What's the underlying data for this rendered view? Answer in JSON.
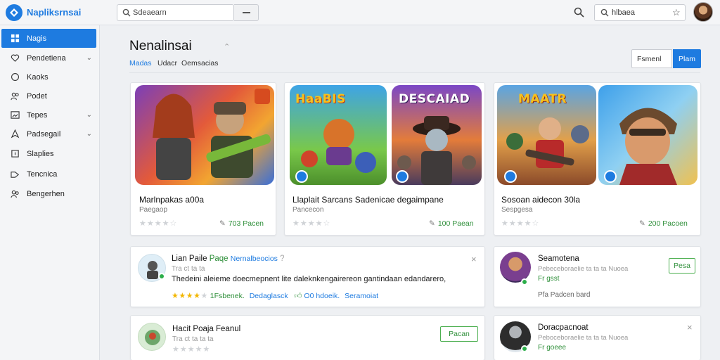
{
  "app": {
    "brand": "Napliksrnsai"
  },
  "search": {
    "placeholder": "Sdeaearn",
    "value": "Sdeaearn"
  },
  "user": {
    "label": "hlbaea"
  },
  "sidebar": {
    "items": [
      {
        "label": "Nagis",
        "icon": "apps-icon"
      },
      {
        "label": "Pendetiena",
        "icon": "heart-icon"
      },
      {
        "label": "Kaoks",
        "icon": "circle-icon"
      },
      {
        "label": "Podet",
        "icon": "people-icon"
      },
      {
        "label": "Tepes",
        "icon": "image-icon"
      },
      {
        "label": "Padsegail",
        "icon": "bookmark-icon"
      },
      {
        "label": "Slaplies",
        "icon": "square-icon"
      },
      {
        "label": "Tencnica",
        "icon": "tag-icon"
      },
      {
        "label": "Bengerhen",
        "icon": "people-icon"
      }
    ]
  },
  "main": {
    "title": "Nenalinsai",
    "tabs": [
      "Madas",
      "Udacr",
      "Oemsacias"
    ],
    "sort": {
      "value": "Fsmenl",
      "button": "Plam"
    }
  },
  "games": [
    {
      "thumb_a_title": "",
      "title": "Marlnpakas a00a",
      "sub": "Paegaop",
      "rating": 0,
      "link": "703 Pacen"
    },
    {
      "thumb_a_title": "HaaBIS",
      "thumb_b_title": "DESCAIAD",
      "title": "Llaplait Sarcans Sadenicae degaimpane",
      "sub": "Pancecon",
      "rating": 0,
      "link": "100 Paean"
    },
    {
      "thumb_a_title": "MAATR",
      "title": "Sosoan aidecon 30la",
      "sub": "Sespgesa",
      "rating": 0,
      "link": "200 Pacoen"
    }
  ],
  "feed": [
    {
      "name": "Lian Paile",
      "name_tag": "Paqe",
      "link": "Nernalbeocios",
      "meta": "Tra ct ta ta",
      "body": "Thedeini aleieme doecmepnent lite daleknkengairereon gantindaan edandarero,",
      "rating": 4,
      "r_label": "1Fsbenek.",
      "a1": "Dedaglasck",
      "a2": "O0 hdoeik.",
      "a3": "Seramoiat"
    },
    {
      "name": "Hacit Poaja Feanul",
      "meta": "Tra ct ta ta ta",
      "button": "Pacan"
    }
  ],
  "suggest": [
    {
      "name": "Seamotena",
      "meta": "Pebeceboraelie ta ta  ta Nuoea",
      "status": "Fr gsst",
      "tag": "Pfa  Padcen bard",
      "button": "Pesa"
    },
    {
      "name": "Doracpacnoat",
      "meta": "Peboceboraelie ta ta  ta Nuoea",
      "status": "Fr goeee"
    }
  ],
  "colors": {
    "accent": "#1e7be0",
    "green": "#2f8f3a",
    "star": "#f2b600"
  }
}
